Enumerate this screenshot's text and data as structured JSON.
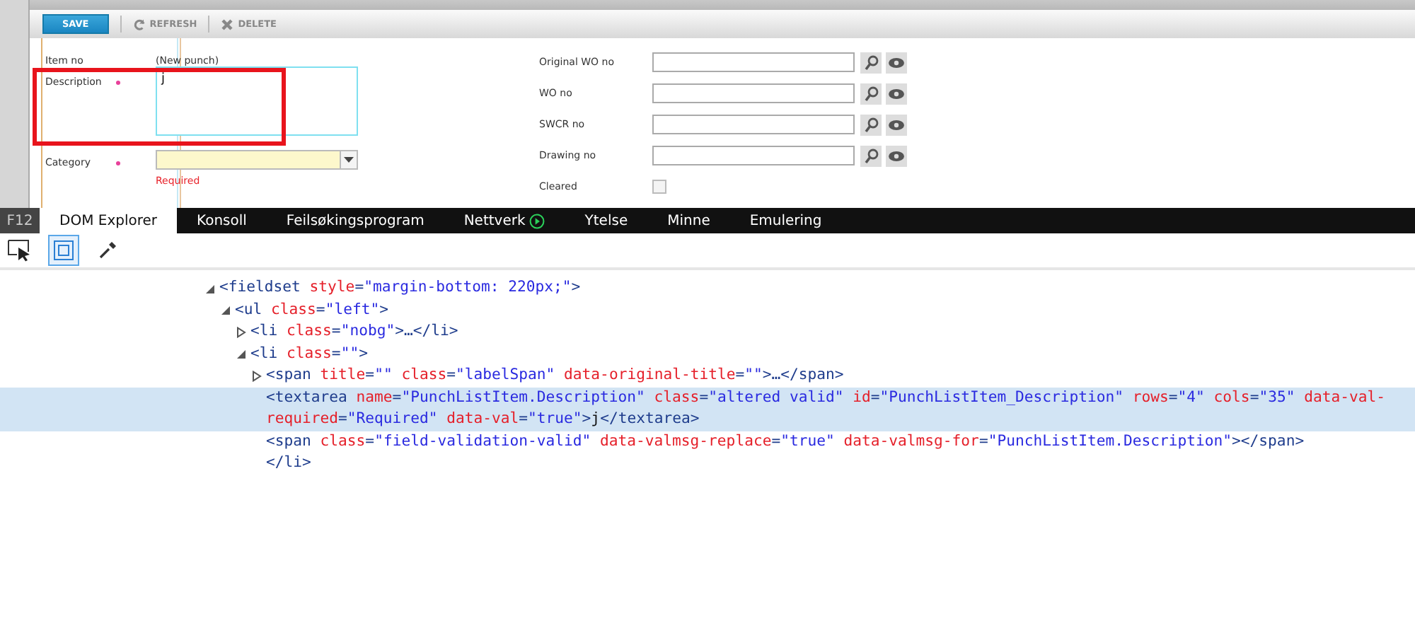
{
  "toolbar": {
    "buttons": [
      {
        "label": "SAVE",
        "kind": "primary",
        "disabled": false
      },
      {
        "label": "REFRESH",
        "kind": "refresh",
        "disabled": true
      },
      {
        "label": "DELETE",
        "kind": "delete",
        "disabled": true
      }
    ]
  },
  "form": {
    "left_fields": [
      {
        "label": "Item no",
        "required": false,
        "kind": "text",
        "value": "(New punch)"
      },
      {
        "label": "Description",
        "required": true,
        "kind": "textarea",
        "value": "j",
        "highlighted": true
      },
      {
        "label": "Category",
        "required": true,
        "kind": "select",
        "error": "Required"
      }
    ],
    "right_fields": [
      {
        "label": "Original WO no",
        "kind": "lookup"
      },
      {
        "label": "WO no",
        "kind": "lookup"
      },
      {
        "label": "SWCR no",
        "kind": "lookup"
      },
      {
        "label": "Drawing no",
        "kind": "lookup"
      },
      {
        "label": "Cleared",
        "kind": "checkbox",
        "checked": false
      }
    ]
  },
  "devtools": {
    "f12_label": "F12",
    "tabs": [
      {
        "label": "DOM Explorer",
        "selected": true,
        "kind": "plain"
      },
      {
        "label": "Konsoll",
        "selected": false,
        "kind": "plain"
      },
      {
        "label": "Feilsøkingsprogram",
        "selected": false,
        "kind": "plain"
      },
      {
        "label": "Nettverk",
        "selected": false,
        "kind": "play"
      },
      {
        "label": "Ytelse",
        "selected": false,
        "kind": "plain"
      },
      {
        "label": "Minne",
        "selected": false,
        "kind": "plain"
      },
      {
        "label": "Emulering",
        "selected": false,
        "kind": "plain"
      }
    ],
    "tools": [
      {
        "kind": "select-element",
        "selected": false
      },
      {
        "kind": "highlight-box",
        "selected": true
      },
      {
        "kind": "color-picker",
        "selected": false
      }
    ],
    "dom_tree": [
      {
        "kind": "element",
        "expanded": true,
        "selected": false,
        "tokens": [
          {
            "kind": "tag",
            "text": "<fieldset"
          },
          {
            "kind": "attr",
            "text": " style"
          },
          {
            "kind": "tag",
            "text": "="
          },
          {
            "kind": "value",
            "text": "\"margin-bottom: 220px;\""
          },
          {
            "kind": "tag",
            "text": ">"
          }
        ],
        "children": [
          {
            "kind": "element",
            "expanded": true,
            "selected": false,
            "tokens": [
              {
                "kind": "tag",
                "text": "<ul"
              },
              {
                "kind": "attr",
                "text": " class"
              },
              {
                "kind": "tag",
                "text": "="
              },
              {
                "kind": "value",
                "text": "\"left\""
              },
              {
                "kind": "tag",
                "text": ">"
              }
            ],
            "children": [
              {
                "kind": "element",
                "expanded": false,
                "selected": false,
                "tokens": [
                  {
                    "kind": "tag",
                    "text": "<li"
                  },
                  {
                    "kind": "attr",
                    "text": " class"
                  },
                  {
                    "kind": "tag",
                    "text": "="
                  },
                  {
                    "kind": "value",
                    "text": "\"nobg\""
                  },
                  {
                    "kind": "tag",
                    "text": ">…</li>"
                  }
                ]
              },
              {
                "kind": "element",
                "expanded": true,
                "selected": false,
                "tokens": [
                  {
                    "kind": "tag",
                    "text": "<li"
                  },
                  {
                    "kind": "attr",
                    "text": " class"
                  },
                  {
                    "kind": "tag",
                    "text": "="
                  },
                  {
                    "kind": "value",
                    "text": "\"\""
                  },
                  {
                    "kind": "tag",
                    "text": ">"
                  }
                ],
                "children": [
                  {
                    "kind": "element",
                    "expanded": false,
                    "selected": false,
                    "tokens": [
                      {
                        "kind": "tag",
                        "text": "<span"
                      },
                      {
                        "kind": "attr",
                        "text": " title"
                      },
                      {
                        "kind": "tag",
                        "text": "="
                      },
                      {
                        "kind": "value",
                        "text": "\"\""
                      },
                      {
                        "kind": "attr",
                        "text": " class"
                      },
                      {
                        "kind": "tag",
                        "text": "="
                      },
                      {
                        "kind": "value",
                        "text": "\"labelSpan\""
                      },
                      {
                        "kind": "attr",
                        "text": " data-original-title"
                      },
                      {
                        "kind": "tag",
                        "text": "="
                      },
                      {
                        "kind": "value",
                        "text": "\"\""
                      },
                      {
                        "kind": "tag",
                        "text": ">…</span>"
                      }
                    ]
                  },
                  {
                    "kind": "leaf",
                    "selected": true,
                    "tokens": [
                      {
                        "kind": "tag",
                        "text": "<textarea"
                      },
                      {
                        "kind": "attr",
                        "text": " name"
                      },
                      {
                        "kind": "tag",
                        "text": "="
                      },
                      {
                        "kind": "value",
                        "text": "\"PunchListItem.Description\""
                      },
                      {
                        "kind": "attr",
                        "text": " class"
                      },
                      {
                        "kind": "tag",
                        "text": "="
                      },
                      {
                        "kind": "value",
                        "text": "\"altered valid\""
                      },
                      {
                        "kind": "attr",
                        "text": " id"
                      },
                      {
                        "kind": "tag",
                        "text": "="
                      },
                      {
                        "kind": "value",
                        "text": "\"PunchListItem_Description\""
                      },
                      {
                        "kind": "attr",
                        "text": " rows"
                      },
                      {
                        "kind": "tag",
                        "text": "="
                      },
                      {
                        "kind": "value",
                        "text": "\"4\""
                      },
                      {
                        "kind": "attr",
                        "text": " cols"
                      },
                      {
                        "kind": "tag",
                        "text": "="
                      },
                      {
                        "kind": "value",
                        "text": "\"35\""
                      },
                      {
                        "kind": "attr",
                        "text": " data-val-required"
                      },
                      {
                        "kind": "tag",
                        "text": "="
                      },
                      {
                        "kind": "value",
                        "text": "\"Required\""
                      },
                      {
                        "kind": "attr",
                        "text": " data-val"
                      },
                      {
                        "kind": "tag",
                        "text": "="
                      },
                      {
                        "kind": "value",
                        "text": "\"true\""
                      },
                      {
                        "kind": "tag",
                        "text": ">"
                      },
                      {
                        "kind": "text",
                        "text": "j"
                      },
                      {
                        "kind": "tag",
                        "text": "</textarea>"
                      }
                    ]
                  },
                  {
                    "kind": "leaf",
                    "selected": false,
                    "tokens": [
                      {
                        "kind": "tag",
                        "text": "<span"
                      },
                      {
                        "kind": "attr",
                        "text": " class"
                      },
                      {
                        "kind": "tag",
                        "text": "="
                      },
                      {
                        "kind": "value",
                        "text": "\"field-validation-valid\""
                      },
                      {
                        "kind": "attr",
                        "text": " data-valmsg-replace"
                      },
                      {
                        "kind": "tag",
                        "text": "="
                      },
                      {
                        "kind": "value",
                        "text": "\"true\""
                      },
                      {
                        "kind": "attr",
                        "text": " data-valmsg-for"
                      },
                      {
                        "kind": "tag",
                        "text": "="
                      },
                      {
                        "kind": "value",
                        "text": "\"PunchListItem.Description\""
                      },
                      {
                        "kind": "tag",
                        "text": "></span>"
                      }
                    ]
                  },
                  {
                    "kind": "close",
                    "selected": false,
                    "tokens": [
                      {
                        "kind": "tag",
                        "text": "</li>"
                      }
                    ]
                  }
                ]
              }
            ]
          }
        ]
      }
    ]
  }
}
